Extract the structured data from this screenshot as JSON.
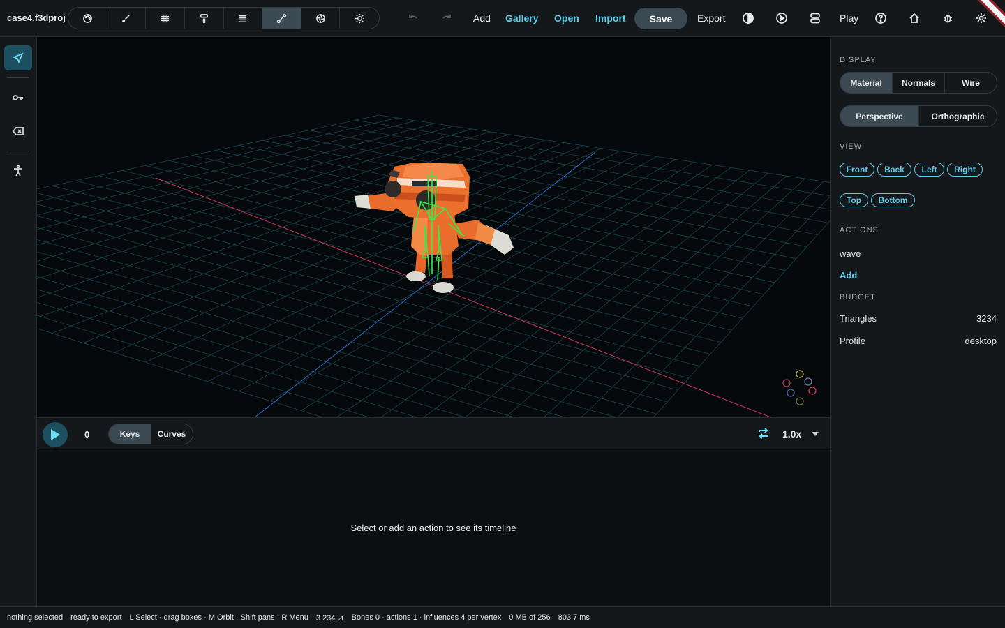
{
  "app": {
    "project_name": "case4.f3dproj"
  },
  "toolbar": {
    "modes": [
      {
        "name": "palette-icon",
        "active": false
      },
      {
        "name": "brush-icon",
        "active": false
      },
      {
        "name": "grid-icon",
        "active": false
      },
      {
        "name": "paint-roller-icon",
        "active": false
      },
      {
        "name": "layers-icon",
        "active": false
      },
      {
        "name": "bone-icon",
        "active": true
      },
      {
        "name": "aperture-icon",
        "active": false
      },
      {
        "name": "sun-icon",
        "active": false
      }
    ],
    "add_label": "Add",
    "gallery_label": "Gallery",
    "open_label": "Open",
    "import_label": "Import",
    "save_label": "Save",
    "export_label": "Export",
    "play_label": "Play"
  },
  "left_tools": [
    {
      "name": "select-tool-icon",
      "active": true
    },
    {
      "name": "key-icon",
      "active": false
    },
    {
      "name": "delete-icon",
      "active": false
    },
    {
      "name": "rig-figure-icon",
      "active": false
    }
  ],
  "timeline": {
    "frame": "0",
    "keys_label": "Keys",
    "curves_label": "Curves",
    "speed": "1.0x",
    "empty_message": "Select or add an action to see its timeline"
  },
  "panel": {
    "display_title": "DISPLAY",
    "shading": [
      "Material",
      "Normals",
      "Wire"
    ],
    "shading_active": "Material",
    "projection": [
      "Perspective",
      "Orthographic"
    ],
    "projection_active": "Perspective",
    "view_title": "VIEW",
    "views": [
      "Front",
      "Back",
      "Left",
      "Right",
      "Top",
      "Bottom"
    ],
    "actions_title": "ACTIONS",
    "actions": [
      "wave"
    ],
    "add_action_label": "Add",
    "budget_title": "BUDGET",
    "triangles_label": "Triangles",
    "triangles_value": "3234",
    "profile_label": "Profile",
    "profile_value": "desktop"
  },
  "status": {
    "selection": "nothing selected",
    "export_state": "ready to export",
    "hints": "L Select · drag boxes · M Orbit · Shift pans · R Menu",
    "triangles": "3 234 ⊿",
    "rig": "Bones 0 · actions 1 · influences 4 per vertex",
    "memory": "0 MB of 256",
    "timing": "803.7 ms"
  },
  "colors": {
    "accent": "#5ccde8",
    "active_fill": "#3b4a52",
    "model_orange": "#e8692a",
    "bone_green": "#39e84a"
  }
}
